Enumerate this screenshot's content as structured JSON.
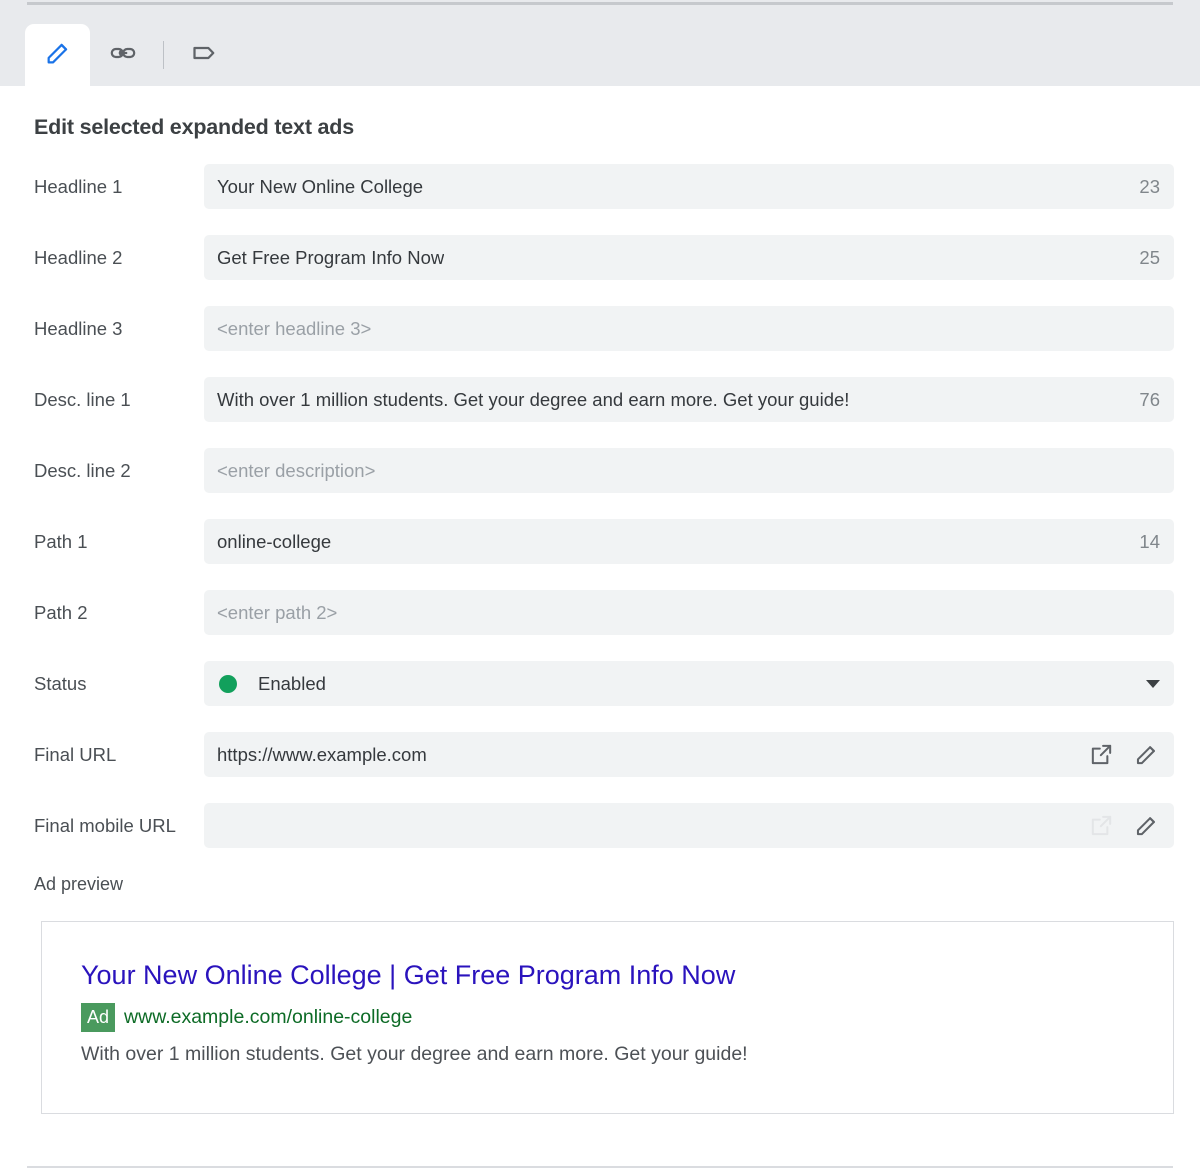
{
  "tabs": [
    {
      "name": "edit-tab",
      "icon": "pencil-icon",
      "active": true
    },
    {
      "name": "link-tab",
      "icon": "link-icon",
      "active": false
    },
    {
      "name": "label-tab",
      "icon": "tag-icon",
      "active": false
    }
  ],
  "header": {
    "title": "Edit selected expanded text ads"
  },
  "fields": {
    "headline1": {
      "label": "Headline 1",
      "value": "Your New Online College",
      "value_pre": "Your New ",
      "value_misspelled": "Online",
      "value_post": " College",
      "counter": "23"
    },
    "headline2": {
      "label": "Headline 2",
      "value": "Get Free Program Info Now",
      "counter": "25"
    },
    "headline3": {
      "label": "Headline 3",
      "placeholder": "<enter headline 3>",
      "counter": ""
    },
    "desc1": {
      "label": "Desc. line 1",
      "value": "With over 1 million students. Get your degree and earn more. Get your guide",
      "value_misspelled": "!",
      "counter": "76"
    },
    "desc2": {
      "label": "Desc. line 2",
      "placeholder": "<enter description>",
      "counter": ""
    },
    "path1": {
      "label": "Path 1",
      "value_misspelled": "online-",
      "value_post": "college",
      "counter": "14"
    },
    "path2": {
      "label": "Path 2",
      "placeholder": "<enter path 2>",
      "counter": ""
    },
    "status": {
      "label": "Status",
      "value": "Enabled",
      "dot_color": "#12a05c"
    },
    "final_url": {
      "label": "Final URL",
      "value": "https://www.example.com"
    },
    "final_mobile_url": {
      "label": "Final mobile URL",
      "value": ""
    }
  },
  "preview": {
    "label": "Ad preview",
    "headline": "Your New Online College | Get Free Program Info Now",
    "ad_badge": "Ad",
    "url": "www.example.com/online-college",
    "description": "With over 1 million students. Get your degree and earn more. Get your guide!"
  },
  "colors": {
    "accent_blue": "#1a73e8",
    "preview_link": "#2a13bd",
    "preview_url_green": "#0d6b26",
    "ad_badge_green": "#4a9a5e",
    "status_green": "#12a05c",
    "field_bg": "#f1f3f4",
    "spellcheck_red": "#e53935"
  }
}
